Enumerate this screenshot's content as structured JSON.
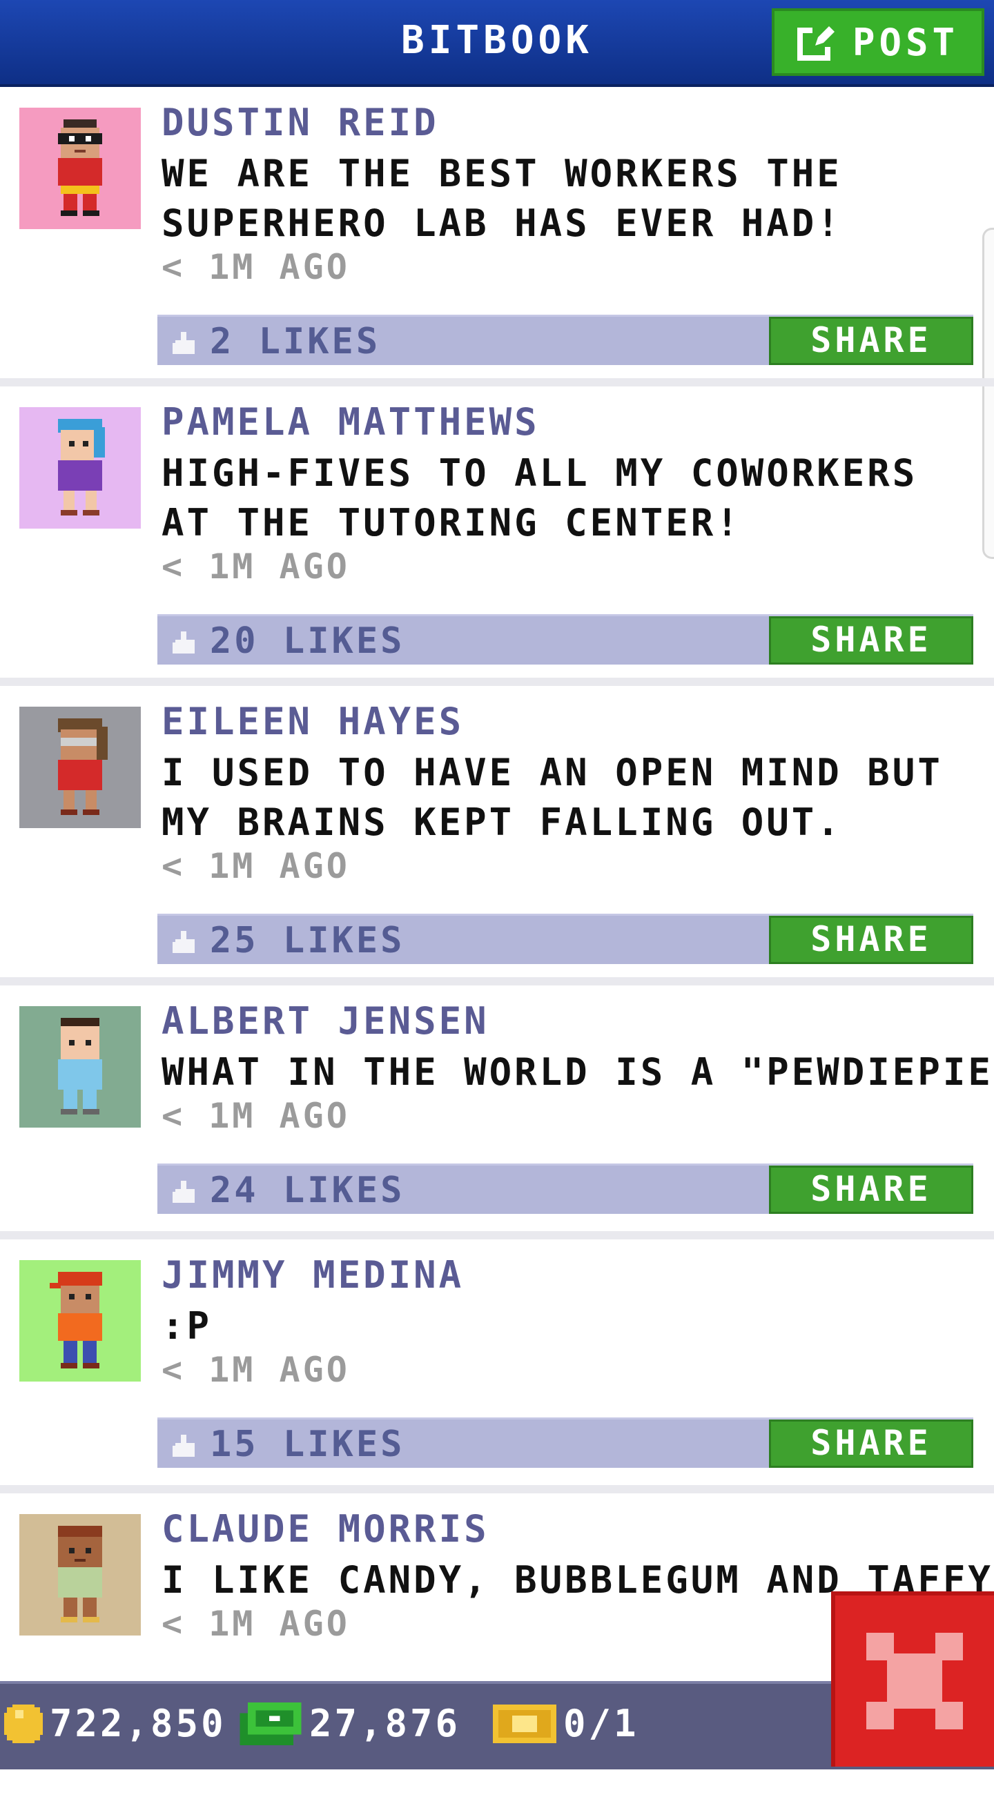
{
  "header": {
    "title": "BITBOOK",
    "post_label": "POST"
  },
  "posts": [
    {
      "name": "DUSTIN REID",
      "text": "WE ARE THE BEST WORKERS THE SUPERHERO LAB HAS EVER HAD!",
      "time": "< 1M AGO",
      "likes": "2 LIKES",
      "share": "SHARE",
      "avatar_bg": "#f59bc0"
    },
    {
      "name": "PAMELA MATTHEWS",
      "text": "HIGH-FIVES TO ALL MY COWORKERS AT THE TUTORING CENTER!",
      "time": "< 1M AGO",
      "likes": "20 LIKES",
      "share": "SHARE",
      "avatar_bg": "#e6b8f2"
    },
    {
      "name": "EILEEN HAYES",
      "text": "I USED TO HAVE AN OPEN MIND BUT MY BRAINS KEPT FALLING OUT.",
      "time": "< 1M AGO",
      "likes": "25 LIKES",
      "share": "SHARE",
      "avatar_bg": "#999aa0"
    },
    {
      "name": "ALBERT JENSEN",
      "text": "WHAT IN THE WORLD IS A \"PEWDIEPIE\"?",
      "time": "< 1M AGO",
      "likes": "24 LIKES",
      "share": "SHARE",
      "avatar_bg": "#82ab91"
    },
    {
      "name": "JIMMY MEDINA",
      "text": ":P",
      "time": "< 1M AGO",
      "likes": "15 LIKES",
      "share": "SHARE",
      "avatar_bg": "#a3ef7c"
    },
    {
      "name": "CLAUDE MORRIS",
      "text": "I LIKE CANDY, BUBBLEGUM AND TAFFY",
      "time": "< 1M AGO",
      "likes": "",
      "share": "",
      "avatar_bg": "#d2bd96"
    }
  ],
  "footer": {
    "coins": "722,850",
    "bux": "27,876",
    "tickets": "0/1"
  },
  "colors": {
    "header": "#1d47b3",
    "post_button": "#38b12a",
    "share_button": "#3fa12f",
    "like_bar": "#b3b6d9",
    "close": "#dc2323"
  }
}
